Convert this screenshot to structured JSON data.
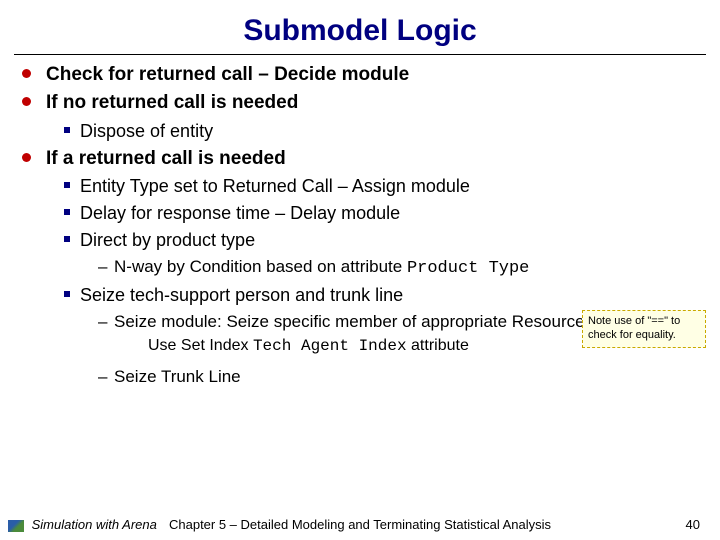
{
  "title": "Submodel Logic",
  "bullets": {
    "b1": "Check for returned call – Decide module",
    "b2": "If no returned call is needed",
    "b2_1": "Dispose of entity",
    "b3": "If a returned call is needed",
    "b3_1": "Entity Type set to Returned Call – Assign module",
    "b3_2": "Delay for response time – Delay module",
    "b3_3": "Direct by product type",
    "b3_3_1a": "N-way by Condition based on attribute ",
    "b3_3_1b": "Product Type",
    "b3_4": "Seize tech-support person and trunk line",
    "b3_4_1": "Seize module:  Seize specific member of appropriate Resource set",
    "b3_4_1_1a": "Use Set Index ",
    "b3_4_1_1b": "Tech Agent Index",
    "b3_4_1_1c": " attribute",
    "b3_4_2": "Seize Trunk Line"
  },
  "note": "Note use of \"==\" to check for equality.",
  "footer": {
    "sim": "Simulation with Arena",
    "chapter": "Chapter 5 – Detailed Modeling and Terminating Statistical Analysis",
    "page": "40"
  }
}
